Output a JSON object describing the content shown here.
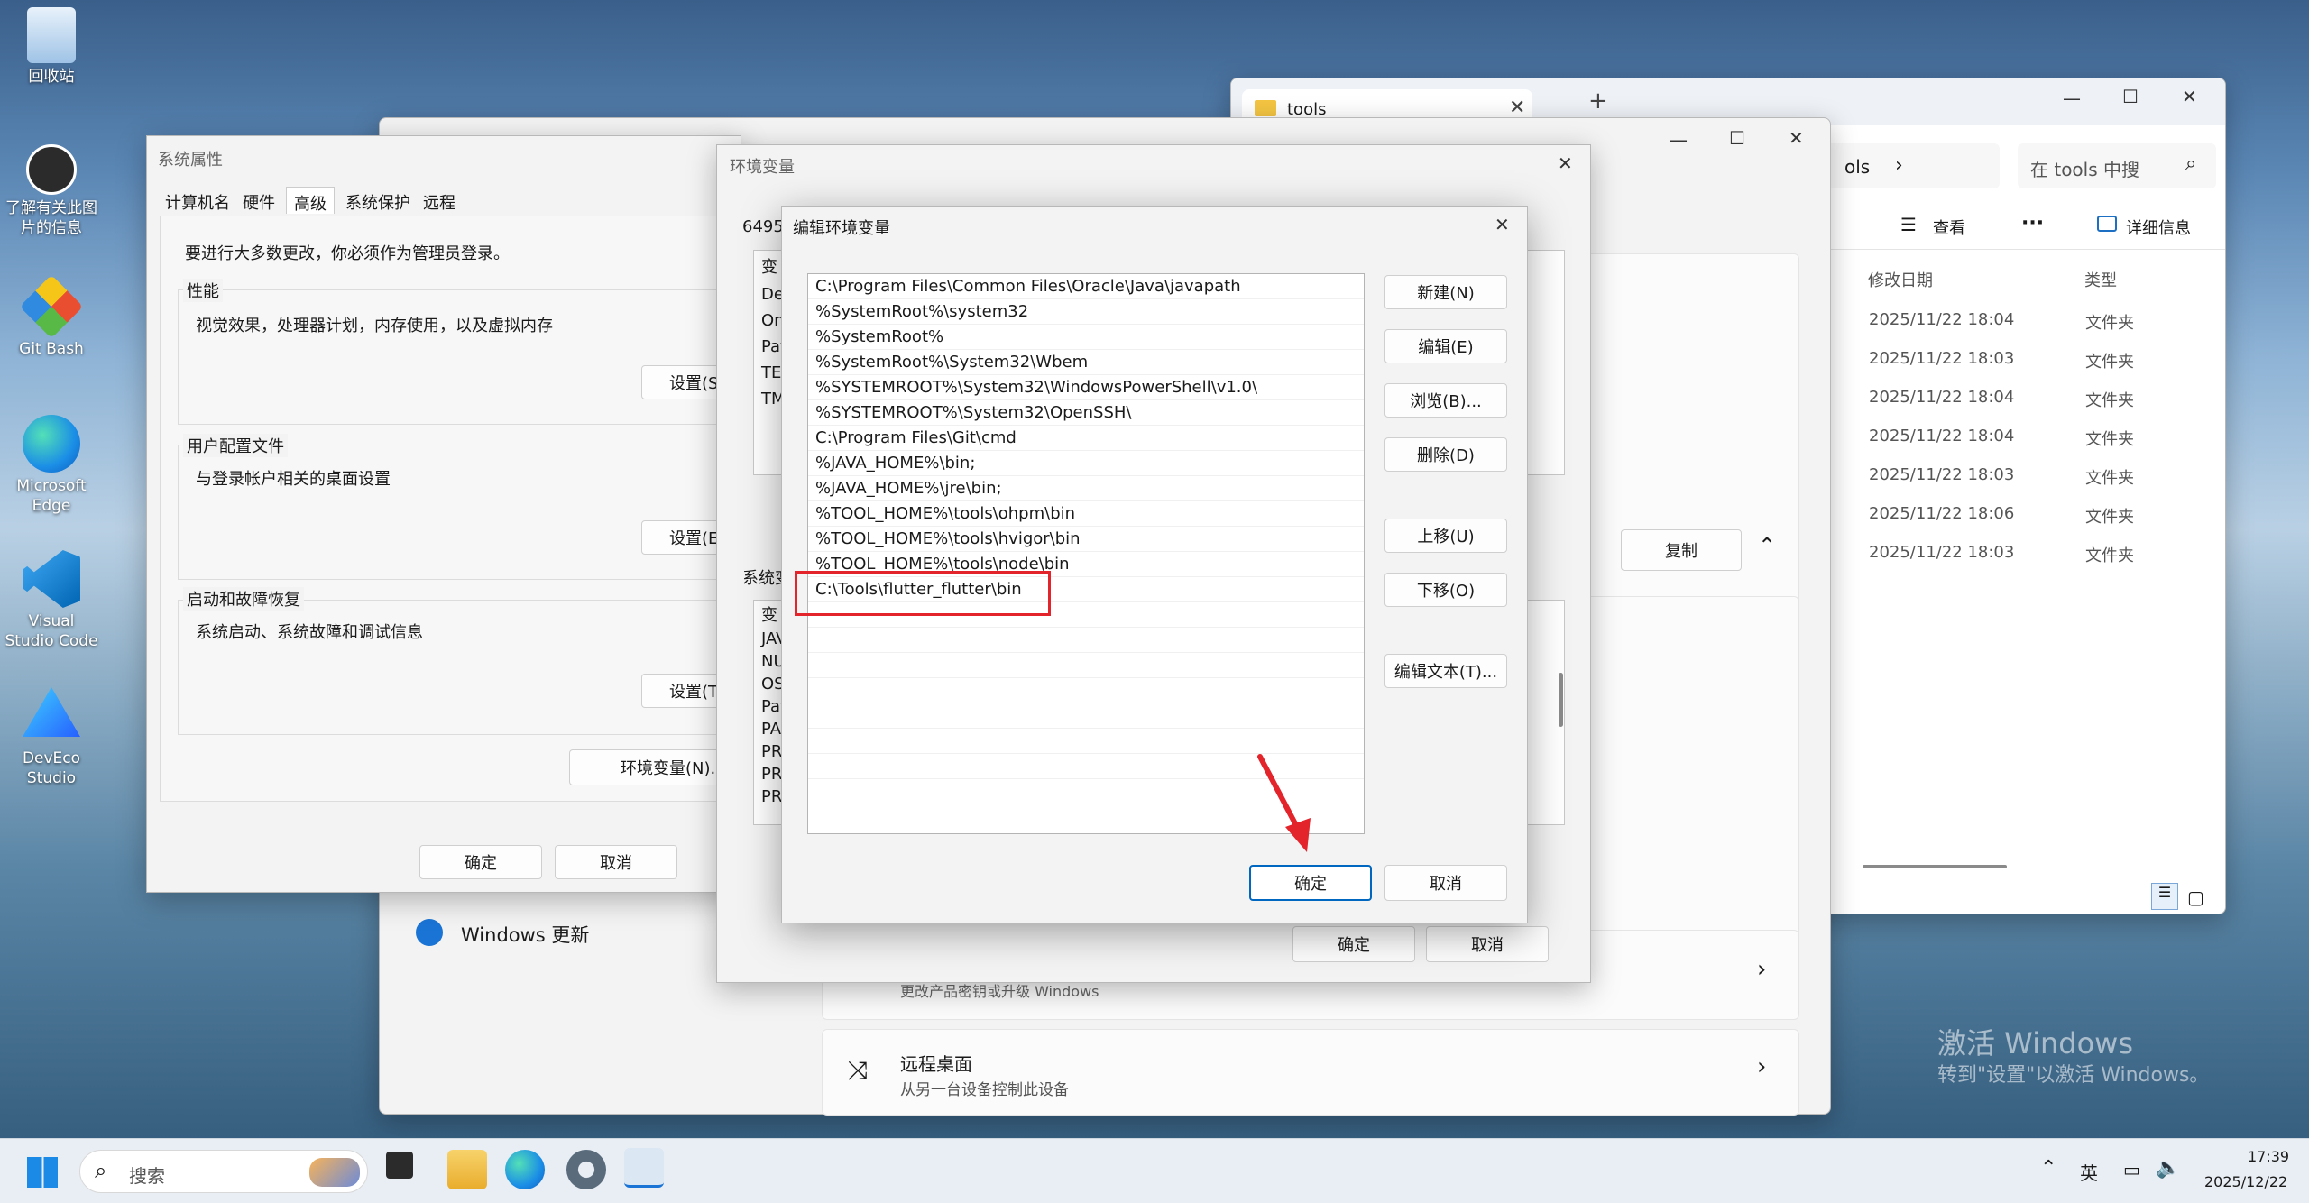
{
  "desktop": {
    "icons": [
      {
        "label": "回收站"
      },
      {
        "label": "了解有关此图片的信息"
      },
      {
        "label": "Git Bash"
      },
      {
        "label": "Microsoft Edge"
      },
      {
        "label": "Visual Studio Code"
      },
      {
        "label": "DevEco Studio"
      }
    ]
  },
  "explorer": {
    "tab_title": "tools",
    "tab_add": "+",
    "breadcrumb_tail": "ols",
    "search_placeholder": "在 tools 中搜",
    "toolbar": {
      "view": "查看",
      "more": "···",
      "details": "详细信息"
    },
    "columns": {
      "modified": "修改日期",
      "type": "类型"
    },
    "rows": [
      {
        "date": "2025/11/22 18:04",
        "type": "文件夹"
      },
      {
        "date": "2025/11/22 18:03",
        "type": "文件夹"
      },
      {
        "date": "2025/11/22 18:04",
        "type": "文件夹"
      },
      {
        "date": "2025/11/22 18:04",
        "type": "文件夹"
      },
      {
        "date": "2025/11/22 18:03",
        "type": "文件夹"
      },
      {
        "date": "2025/11/22 18:06",
        "type": "文件夹"
      },
      {
        "date": "2025/11/22 18:03",
        "type": "文件夹"
      }
    ]
  },
  "settings": {
    "copy_label": "复制",
    "windows_update": "Windows 更新",
    "item1_sub": "更改产品密钥或升级 Windows",
    "remote_title": "远程桌面",
    "remote_sub": "从另一台设备控制此设备"
  },
  "sysprops": {
    "title": "系统属性",
    "tabs": [
      "计算机名",
      "硬件",
      "高级",
      "系统保护",
      "远程"
    ],
    "admin_note": "要进行大多数更改，你必须作为管理员登录。",
    "perf_title": "性能",
    "perf_desc": "视觉效果，处理器计划，内存使用，以及虚拟内存",
    "perf_btn": "设置(S)...",
    "profile_title": "用户配置文件",
    "profile_desc": "与登录帐户相关的桌面设置",
    "profile_btn": "设置(E)...",
    "startup_title": "启动和故障恢复",
    "startup_desc": "系统启动、系统故障和调试信息",
    "startup_btn": "设置(T)...",
    "env_btn": "环境变量(N)...",
    "ok": "确定",
    "cancel": "取消"
  },
  "envvars": {
    "title": "环境变量",
    "user_label": "6495",
    "user_items": [
      "变",
      "De",
      "On",
      "Pat",
      "TEI",
      "TM"
    ],
    "sys_label": "系统变",
    "sys_items": [
      "变",
      "JAV",
      "NU",
      "OS",
      "Pat",
      "PA",
      "PR",
      "PR",
      "PR"
    ],
    "ok": "确定",
    "cancel": "取消"
  },
  "editenv": {
    "title": "编辑环境变量",
    "paths": [
      "C:\\Program Files\\Common Files\\Oracle\\Java\\javapath",
      "%SystemRoot%\\system32",
      "%SystemRoot%",
      "%SystemRoot%\\System32\\Wbem",
      "%SYSTEMROOT%\\System32\\WindowsPowerShell\\v1.0\\",
      "%SYSTEMROOT%\\System32\\OpenSSH\\",
      "C:\\Program Files\\Git\\cmd",
      "%JAVA_HOME%\\bin;",
      "%JAVA_HOME%\\jre\\bin;",
      "%TOOL_HOME%\\tools\\ohpm\\bin",
      "%TOOL_HOME%\\tools\\hvigor\\bin",
      "%TOOL_HOME%\\tools\\node\\bin",
      "C:\\Tools\\flutter_flutter\\bin"
    ],
    "buttons": {
      "new": "新建(N)",
      "edit": "编辑(E)",
      "browse": "浏览(B)...",
      "delete": "删除(D)",
      "up": "上移(U)",
      "down": "下移(O)",
      "edit_text": "编辑文本(T)..."
    },
    "ok": "确定",
    "cancel": "取消"
  },
  "watermark": {
    "line1": "激活 Windows",
    "line2": "转到\"设置\"以激活 Windows。"
  },
  "taskbar": {
    "search_placeholder": "搜索",
    "ime": "英",
    "time": "17:39",
    "date": "2025/12/22"
  }
}
